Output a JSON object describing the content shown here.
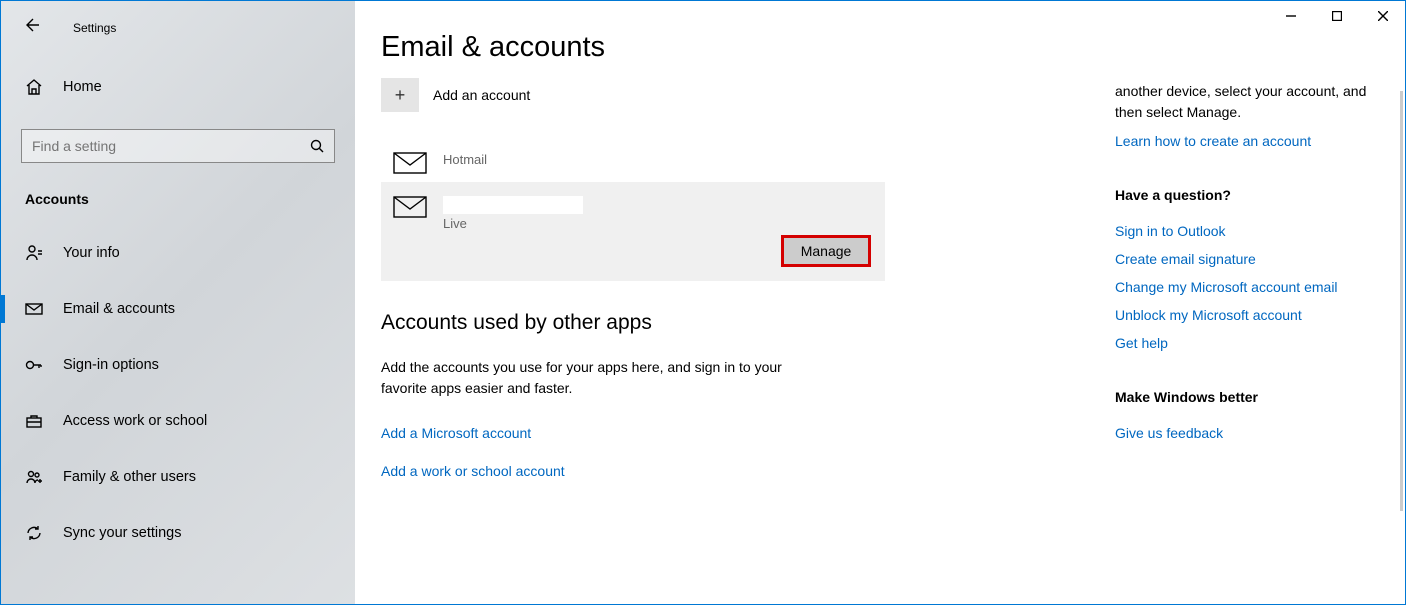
{
  "window": {
    "title": "Settings"
  },
  "sidebar": {
    "home": "Home",
    "search_placeholder": "Find a setting",
    "category": "Accounts",
    "items": [
      {
        "label": "Your info"
      },
      {
        "label": "Email & accounts"
      },
      {
        "label": "Sign-in options"
      },
      {
        "label": "Access work or school"
      },
      {
        "label": "Family & other users"
      },
      {
        "label": "Sync your settings"
      }
    ]
  },
  "main": {
    "heading": "Email & accounts",
    "add_account": "Add an account",
    "accounts": [
      {
        "provider": "Hotmail"
      },
      {
        "provider": "Live"
      }
    ],
    "manage": "Manage",
    "other_apps_heading": "Accounts used by other apps",
    "other_apps_desc": "Add the accounts you use for your apps here, and sign in to your favorite apps easier and faster.",
    "add_ms": "Add a Microsoft account",
    "add_work": "Add a work or school account"
  },
  "right": {
    "info": "another device, select your account, and then select Manage.",
    "learn_link": "Learn how to create an account",
    "question_head": "Have a question?",
    "help_links": [
      "Sign in to Outlook",
      "Create email signature",
      "Change my Microsoft account email",
      "Unblock my Microsoft account",
      "Get help"
    ],
    "better_head": "Make Windows better",
    "feedback": "Give us feedback"
  }
}
